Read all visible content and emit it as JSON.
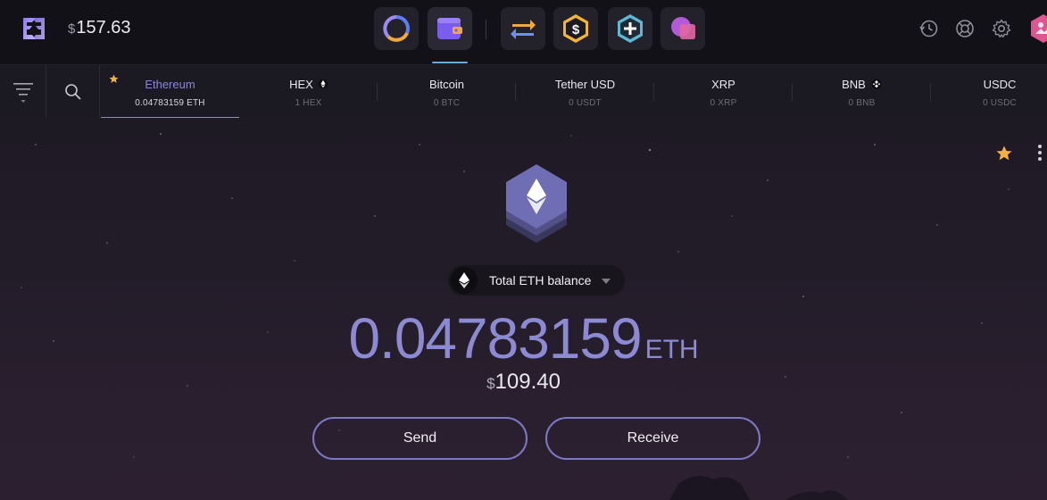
{
  "header": {
    "portfolio_currency": "$",
    "portfolio_value": "157.63",
    "apps": [
      {
        "icon": "portfolio-ring-icon"
      },
      {
        "icon": "wallet-icon",
        "active": true
      },
      {
        "icon": "exchange-icon"
      },
      {
        "icon": "dollar-hexagon-icon"
      },
      {
        "icon": "plus-hexagon-icon"
      },
      {
        "icon": "purple-blob-app-icon"
      }
    ],
    "right_icons": [
      "history-icon",
      "support-lifebuoy-icon",
      "settings-gear-icon",
      "profile-avatar-icon"
    ]
  },
  "assets": {
    "tabs": [
      {
        "name": "Ethereum",
        "balance": "0.04783159 ETH",
        "favorite": true,
        "active": true
      },
      {
        "name": "HEX",
        "balance": "1 HEX",
        "mark": "eth-diamond-icon"
      },
      {
        "name": "Bitcoin",
        "balance": "0 BTC"
      },
      {
        "name": "Tether USD",
        "balance": "0 USDT"
      },
      {
        "name": "XRP",
        "balance": "0 XRP"
      },
      {
        "name": "BNB",
        "balance": "0 BNB",
        "mark": "bnb-icon"
      },
      {
        "name": "USDC",
        "balance": "0 USDC"
      }
    ]
  },
  "main": {
    "selector_label": "Total ETH balance",
    "balance_amount": "0.04783159",
    "balance_unit": "ETH",
    "fiat_currency": "$",
    "fiat_value": "109.40",
    "send_label": "Send",
    "receive_label": "Receive"
  },
  "colors": {
    "accent": "#8a86db",
    "star": "#f5b23a",
    "button_border": "#7c79c4"
  }
}
